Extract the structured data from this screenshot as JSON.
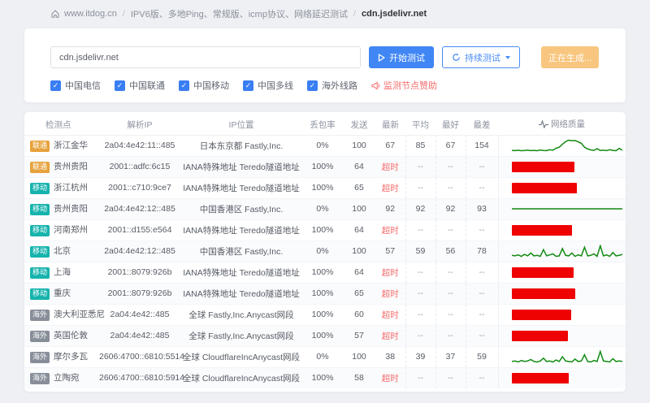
{
  "breadcrumb": {
    "home": "www.itdog.cn",
    "sep": "/",
    "path": "IPV6版、多地Ping、常规版、icmp协议、网络延迟测试",
    "current": "cdn.jsdelivr.net"
  },
  "search": {
    "value": "cdn.jsdelivr.net",
    "start_label": "开始测试",
    "continuous_label": "持续测试",
    "generating_label": "正在生成...",
    "sponsor_label": "监测节点赞助",
    "checkboxes": [
      {
        "label": "中国电信",
        "checked": true
      },
      {
        "label": "中国联通",
        "checked": true
      },
      {
        "label": "中国移动",
        "checked": true
      },
      {
        "label": "中国多线",
        "checked": true
      },
      {
        "label": "海外线路",
        "checked": true
      }
    ]
  },
  "icons": {
    "home": "house-icon",
    "start": "play-icon",
    "continuous": "refresh-icon",
    "dropdown": "chevron-down-icon",
    "sponsor": "megaphone-icon",
    "quality": "pulse-icon",
    "checkbox_glyph": "✓"
  },
  "colors": {
    "primary": "#4086f4",
    "generating": "#f8c67f",
    "danger": "#f56c6c",
    "bar_red": "#ee0202",
    "spark_green": "#128a12",
    "badge_unicom": "#e6a23c",
    "badge_mobile": "#17b3ad",
    "badge_overseas": "#878e99"
  },
  "table": {
    "headers": [
      "检测点",
      "解析IP",
      "IP位置",
      "丢包率",
      "发送",
      "最新",
      "平均",
      "最好",
      "最差",
      "网络质量"
    ],
    "timeout_label": "超时",
    "empty_label": "--",
    "rows": [
      {
        "carrier": "联通",
        "carrier_color": "#e6a23c",
        "node": "浙江金华",
        "ip": "2a04:4e42:11::485",
        "location": "日本东京都 Fastly,Inc.",
        "loss": "0%",
        "sent": "100",
        "latest": "67",
        "avg": "85",
        "best": "67",
        "worst": "154",
        "quality": {
          "type": "spark",
          "values": [
            70,
            68,
            71,
            67,
            69,
            72,
            68,
            70,
            67,
            73,
            69,
            68,
            75,
            71,
            88,
            96,
            120,
            142,
            154,
            149,
            151,
            140,
            128,
            96,
            82,
            74,
            70,
            84,
            69,
            72,
            68,
            75,
            70,
            67,
            86,
            71
          ]
        }
      },
      {
        "carrier": "联通",
        "carrier_color": "#e6a23c",
        "node": "贵州贵阳",
        "ip": "2001::adfc:6c15",
        "location": "IANA特殊地址 Teredo隧道地址",
        "loss": "100%",
        "sent": "64",
        "latest": "超时",
        "avg": "--",
        "best": "--",
        "worst": "--",
        "quality": {
          "type": "bar",
          "width_pct": 57
        }
      },
      {
        "carrier": "移动",
        "carrier_color": "#17b3ad",
        "node": "浙江杭州",
        "ip": "2001::c710:9ce7",
        "location": "IANA特殊地址 Teredo隧道地址",
        "loss": "100%",
        "sent": "65",
        "latest": "超时",
        "avg": "--",
        "best": "--",
        "worst": "--",
        "quality": {
          "type": "bar",
          "width_pct": 59
        }
      },
      {
        "carrier": "移动",
        "carrier_color": "#17b3ad",
        "node": "贵州贵阳",
        "ip": "2a04:4e42:12::485",
        "location": "中国香港区 Fastly,Inc.",
        "loss": "0%",
        "sent": "100",
        "latest": "92",
        "avg": "92",
        "best": "92",
        "worst": "93",
        "quality": {
          "type": "spark",
          "values": [
            92,
            92,
            93,
            92,
            92,
            92,
            93,
            92,
            92,
            93,
            92,
            92,
            92,
            93,
            92,
            92,
            92,
            93,
            92,
            92,
            93,
            92,
            92,
            92,
            93,
            92,
            92,
            93,
            92,
            92,
            92,
            93,
            92,
            92,
            93,
            92
          ]
        }
      },
      {
        "carrier": "移动",
        "carrier_color": "#17b3ad",
        "node": "河南郑州",
        "ip": "2001::d155:e564",
        "location": "IANA特殊地址 Teredo隧道地址",
        "loss": "100%",
        "sent": "64",
        "latest": "超时",
        "avg": "--",
        "best": "--",
        "worst": "--",
        "quality": {
          "type": "bar",
          "width_pct": 55
        }
      },
      {
        "carrier": "移动",
        "carrier_color": "#17b3ad",
        "node": "北京",
        "ip": "2a04:4e42:12::485",
        "location": "中国香港区 Fastly,Inc.",
        "loss": "0%",
        "sent": "100",
        "latest": "57",
        "avg": "59",
        "best": "56",
        "worst": "78",
        "quality": {
          "type": "spark",
          "values": [
            58,
            57,
            59,
            56,
            60,
            57,
            63,
            57,
            58,
            56,
            70,
            57,
            59,
            61,
            56,
            57,
            72,
            58,
            57,
            63,
            56,
            59,
            57,
            75,
            57,
            58,
            61,
            56,
            78,
            57,
            59,
            56,
            64,
            57,
            58,
            60
          ]
        }
      },
      {
        "carrier": "移动",
        "carrier_color": "#17b3ad",
        "node": "上海",
        "ip": "2001::8079:926b",
        "location": "IANA特殊地址 Teredo隧道地址",
        "loss": "100%",
        "sent": "64",
        "latest": "超时",
        "avg": "--",
        "best": "--",
        "worst": "--",
        "quality": {
          "type": "bar",
          "width_pct": 56
        }
      },
      {
        "carrier": "移动",
        "carrier_color": "#17b3ad",
        "node": "重庆",
        "ip": "2001::8079:926b",
        "location": "IANA特殊地址 Teredo隧道地址",
        "loss": "100%",
        "sent": "65",
        "latest": "超时",
        "avg": "--",
        "best": "--",
        "worst": "--",
        "quality": {
          "type": "bar",
          "width_pct": 58
        }
      },
      {
        "carrier": "海外",
        "carrier_color": "#878e99",
        "node": "澳大利亚悉尼",
        "ip": "2a04:4e42::485",
        "location": "全球 Fastly,Inc.Anycast网段",
        "loss": "100%",
        "sent": "60",
        "latest": "超时",
        "avg": "--",
        "best": "--",
        "worst": "--",
        "quality": {
          "type": "bar",
          "width_pct": 54
        }
      },
      {
        "carrier": "海外",
        "carrier_color": "#878e99",
        "node": "英国伦敦",
        "ip": "2a04:4e42::485",
        "location": "全球 Fastly,Inc.Anycast网段",
        "loss": "100%",
        "sent": "57",
        "latest": "超时",
        "avg": "--",
        "best": "--",
        "worst": "--",
        "quality": {
          "type": "bar",
          "width_pct": 51
        }
      },
      {
        "carrier": "海外",
        "carrier_color": "#878e99",
        "node": "摩尔多瓦",
        "ip": "2606:4700::6810:5514",
        "location": "全球 CloudflareIncAnycast网段",
        "loss": "0%",
        "sent": "100",
        "latest": "38",
        "avg": "39",
        "best": "37",
        "worst": "59",
        "quality": {
          "type": "spark",
          "values": [
            38,
            39,
            37,
            40,
            38,
            39,
            42,
            38,
            37,
            39,
            45,
            38,
            39,
            37,
            41,
            38,
            48,
            39,
            38,
            37,
            43,
            38,
            39,
            52,
            38,
            37,
            40,
            38,
            59,
            39,
            38,
            37,
            44,
            38,
            39,
            38
          ]
        }
      },
      {
        "carrier": "海外",
        "carrier_color": "#878e99",
        "node": "立陶宛",
        "ip": "2606:4700::6810:5914",
        "location": "全球 CloudflareIncAnycast网段",
        "loss": "100%",
        "sent": "58",
        "latest": "超时",
        "avg": "--",
        "best": "--",
        "worst": "--",
        "quality": {
          "type": "bar",
          "width_pct": 52
        }
      }
    ]
  }
}
